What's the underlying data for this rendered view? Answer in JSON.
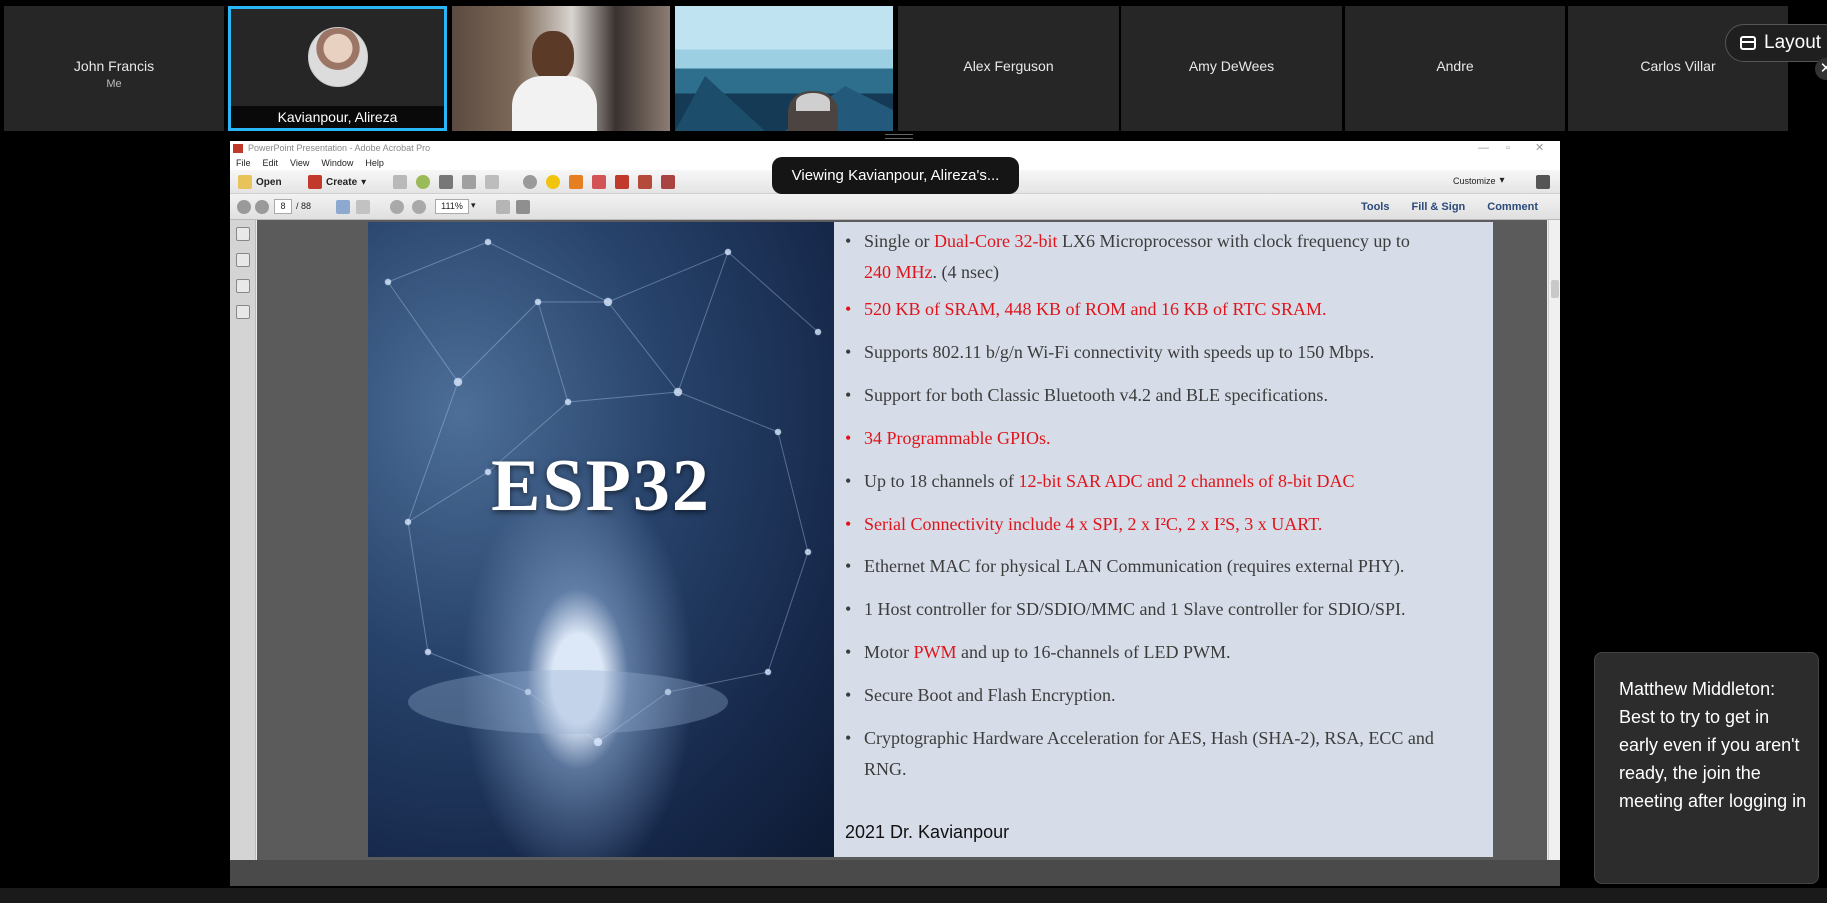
{
  "meeting": {
    "layout_label": "Layout",
    "viewing_banner": "Viewing Kavianpour, Alireza's...",
    "participants": [
      {
        "name": "John Francis",
        "sub": "Me"
      },
      {
        "name": "Kavianpour, Alireza"
      },
      {
        "name": ""
      },
      {
        "name": ""
      },
      {
        "name": "Alex Ferguson"
      },
      {
        "name": "Amy DeWees"
      },
      {
        "name": "Andre"
      },
      {
        "name": "Carlos Villar"
      }
    ],
    "active_speaker_color": "#29b6f6"
  },
  "acrobat": {
    "title": "PowerPoint Presentation - Adobe Acrobat Pro",
    "menu": [
      "File",
      "Edit",
      "View",
      "Window",
      "Help"
    ],
    "toolbar": {
      "open": "Open",
      "create": "Create",
      "customize": "Customize"
    },
    "page_current": "8",
    "page_total": "/ 88",
    "zoom": "111%",
    "right_links": [
      "Tools",
      "Fill & Sign",
      "Comment"
    ]
  },
  "slide": {
    "title": "ESP32",
    "accent_color": "#e0141a",
    "bullets": [
      {
        "parts": [
          {
            "t": "Single or ",
            "r": false
          },
          {
            "t": "Dual-Core 32-bit",
            "r": true
          },
          {
            "t": " LX6 Microprocessor with clock frequency up to",
            "r": false
          }
        ],
        "line2": [
          {
            "t": "240 MHz",
            "r": true
          },
          {
            "t": ". (4 nsec)",
            "r": false
          }
        ]
      },
      {
        "parts": [
          {
            "t": "520 KB of SRAM, 448 KB of ROM and 16 KB of RTC SRAM.",
            "r": true
          }
        ],
        "red_dot": true
      },
      {
        "parts": [
          {
            "t": "Supports 802.11 b/g/n Wi-Fi connectivity with speeds up to 150 Mbps.",
            "r": false
          }
        ]
      },
      {
        "parts": [
          {
            "t": "Support for both Classic Bluetooth v4.2 and BLE specifications.",
            "r": false
          }
        ]
      },
      {
        "parts": [
          {
            "t": "34 Programmable GPIOs.",
            "r": true
          }
        ],
        "red_dot": true
      },
      {
        "parts": [
          {
            "t": "Up to 18 channels of ",
            "r": false
          },
          {
            "t": "12-bit SAR ADC and 2 channels of 8-bit DAC",
            "r": true
          }
        ]
      },
      {
        "parts": [
          {
            "t": "Serial Connectivity include 4 x SPI, 2 x I²C, 2 x I²S, 3 x UART.",
            "r": true
          }
        ],
        "red_dot": true
      },
      {
        "parts": [
          {
            "t": "Ethernet MAC for physical LAN Communication (requires external PHY).",
            "r": false
          }
        ]
      },
      {
        "parts": [
          {
            "t": "1 Host controller for SD/SDIO/MMC and 1 Slave controller for SDIO/SPI.",
            "r": false
          }
        ]
      },
      {
        "parts": [
          {
            "t": "Motor ",
            "r": false
          },
          {
            "t": "PWM",
            "r": true
          },
          {
            "t": " and up to 16-channels of LED PWM.",
            "r": false
          }
        ]
      },
      {
        "parts": [
          {
            "t": "Secure Boot and Flash Encryption.",
            "r": false
          }
        ]
      },
      {
        "parts": [
          {
            "t": "Cryptographic Hardware Acceleration for AES, Hash (SHA-2), RSA, ECC and",
            "r": false
          }
        ],
        "line2": [
          {
            "t": "RNG.",
            "r": false
          }
        ]
      }
    ],
    "footer": "2021 Dr. Kavianpour"
  },
  "chat_toast": {
    "text": "Matthew Middleton: Best to try to get in early even if you aren't ready, the join the meeting after logging in"
  }
}
